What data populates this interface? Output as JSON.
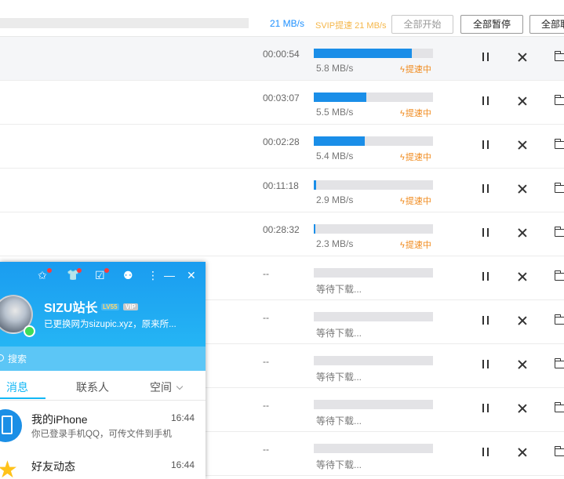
{
  "header": {
    "speed": "21 MB/s",
    "svip_boost": "SVIP提速 21 MB/s",
    "start_all": "全部开始",
    "pause_all": "全部暂停",
    "clear_all": "全部取"
  },
  "downloads": [
    {
      "time": "00:00:54",
      "progress": 0.82,
      "rate": "5.8 MB/s",
      "boost": "提速中"
    },
    {
      "time": "00:03:07",
      "progress": 0.44,
      "rate": "5.5 MB/s",
      "boost": "提速中"
    },
    {
      "time": "00:02:28",
      "progress": 0.43,
      "rate": "5.4 MB/s",
      "boost": "提速中"
    },
    {
      "time": "00:11:18",
      "progress": 0.02,
      "rate": "2.9 MB/s",
      "boost": "提速中"
    },
    {
      "time": "00:28:32",
      "progress": 0.01,
      "rate": "2.3 MB/s",
      "boost": "提速中"
    },
    {
      "time": "--",
      "progress": 0,
      "rate": "等待下载...",
      "boost": ""
    },
    {
      "time": "--",
      "progress": 0,
      "rate": "等待下载...",
      "boost": ""
    },
    {
      "time": "--",
      "progress": 0,
      "rate": "等待下载...",
      "boost": ""
    },
    {
      "time": "--",
      "progress": 0,
      "rate": "等待下载...",
      "boost": ""
    },
    {
      "time": "--",
      "progress": 0,
      "rate": "等待下载...",
      "boost": ""
    }
  ],
  "qq": {
    "name": "SIZU站长",
    "level": "LV55",
    "vip": "VIP",
    "signature": "已更换网为sizupic.xyz，原来所...",
    "search_placeholder": "搜索",
    "tabs": [
      "消息",
      "联系人",
      "空间"
    ],
    "messages": [
      {
        "title": "我的iPhone",
        "sub": "你已登录手机QQ，可传文件到手机",
        "time": "16:44"
      },
      {
        "title": "好友动态",
        "sub": "",
        "time": "16:44"
      }
    ]
  },
  "colors": {
    "accent": "#1a8ee8",
    "qq_blue": "#1a9cf0",
    "boost": "#f08a1c",
    "svip": "#f5b74a"
  }
}
